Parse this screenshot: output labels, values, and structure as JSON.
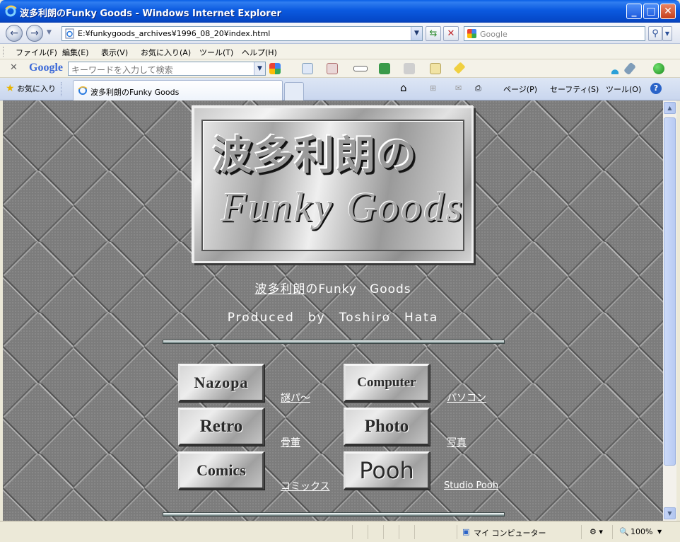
{
  "window": {
    "title": "波多利朗のFunky Goods - Windows Internet Explorer",
    "address": "E:¥funkygoods_archives¥1996_08_20¥index.html",
    "search_placeholder": "Google"
  },
  "menus": [
    "ファイル(F)",
    "編集(E)",
    "表示(V)",
    "お気に入り(A)",
    "ツール(T)",
    "ヘルプ(H)"
  ],
  "google_toolbar": {
    "logo": "Google",
    "search_placeholder": "キーワードを入力して検索"
  },
  "tabbar": {
    "favorites": "お気に入り",
    "tab_label": "波多利朗のFunky Goods",
    "commands": {
      "page": "ページ(P)",
      "safety": "セーフティ(S)",
      "tools": "ツール(O)"
    }
  },
  "page": {
    "logo_jp": "波多利朗の",
    "logo_en": "Funky Goods",
    "subtitle_underlined": "波多利朗",
    "subtitle_rest": "のFunky　Goods",
    "produced": "Produced　by　Toshiro　Hata",
    "nav": [
      {
        "button": "Nazopa",
        "link": "謎パ～"
      },
      {
        "button": "Computer",
        "link": "パソコン"
      },
      {
        "button": "Retro",
        "link": "骨董"
      },
      {
        "button": "Photo",
        "link": "写真"
      },
      {
        "button": "Comics",
        "link": "コミックス"
      },
      {
        "button": "Pooh",
        "link": "Studio Pooh"
      }
    ]
  },
  "statusbar": {
    "zone": "マイ コンピューター",
    "zoom": "100%"
  },
  "colors": {
    "titlebar": "#0b5ae0",
    "content_bg": "#7c7c7c",
    "link": "#ffffff"
  }
}
